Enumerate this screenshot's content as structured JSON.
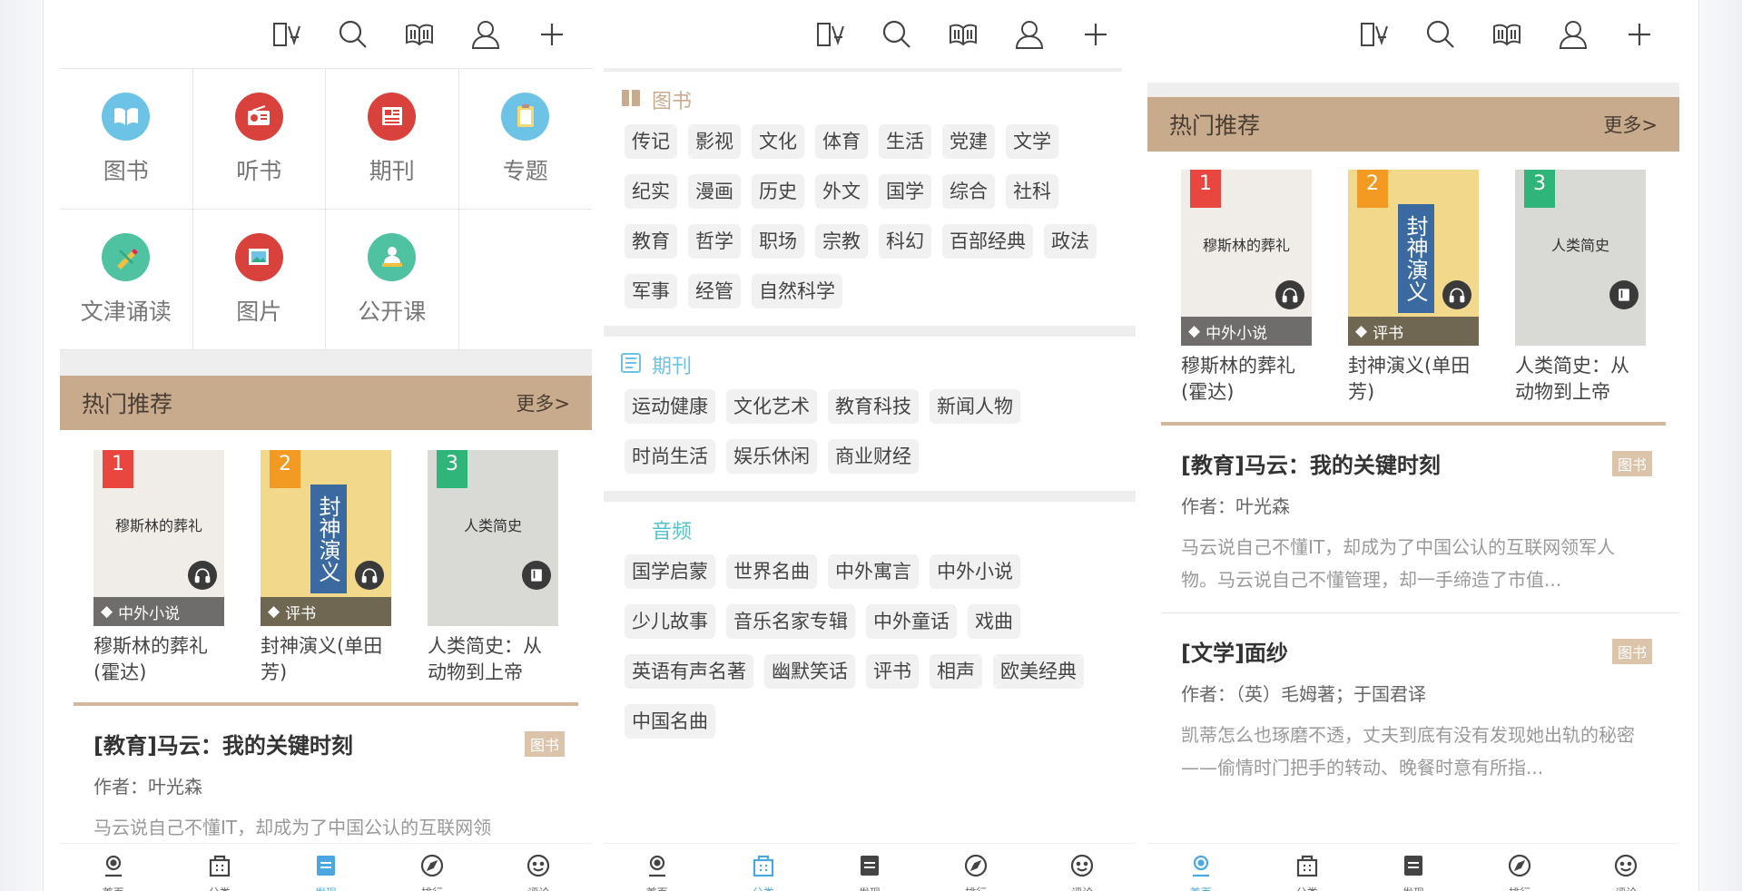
{
  "colors": {
    "accent": "#c8aa8d",
    "active_blue": "#4aa7e0",
    "tag_bg": "#f1f1f1"
  },
  "topbar_icons": [
    "font-icon",
    "search-icon",
    "book-open-icon",
    "user-icon",
    "plus-icon"
  ],
  "screen1": {
    "grid": [
      {
        "label": "图书",
        "icon": "book-icon",
        "color": "#6cc3e6"
      },
      {
        "label": "听书",
        "icon": "radio-icon",
        "color": "#d9423c"
      },
      {
        "label": "期刊",
        "icon": "newspaper-icon",
        "color": "#d9423c"
      },
      {
        "label": "专题",
        "icon": "clipboard-icon",
        "color": "#6cc3e6"
      },
      {
        "label": "文津诵读",
        "icon": "brush-icon",
        "color": "#4fc3a1"
      },
      {
        "label": "图片",
        "icon": "picture-icon",
        "color": "#d9423c"
      },
      {
        "label": "公开课",
        "icon": "teacher-icon",
        "color": "#4fc3a1"
      }
    ]
  },
  "hot": {
    "title": "热门推荐",
    "more": "更多>"
  },
  "books": [
    {
      "rank": "1",
      "rank_color": "#e8463f",
      "tag": "中外小说",
      "badge": "headphones-icon",
      "title": "穆斯林的葬礼(霍达)",
      "cover_title": "穆斯林的葬礼",
      "cover_bg": "#f0ede8"
    },
    {
      "rank": "2",
      "rank_color": "#f39a23",
      "tag": "评书",
      "badge": "headphones-icon",
      "title": "封神演义(单田芳)",
      "cover_title": "封神演义",
      "cover_bg": "#f2d88a"
    },
    {
      "rank": "3",
      "rank_color": "#2fb47a",
      "tag": "",
      "badge": "book-icon",
      "title": "人类简史：从动物到上帝",
      "cover_title": "人类简史",
      "cover_bg": "#d9d9d6"
    }
  ],
  "articles": [
    {
      "title": "[教育]马云：我的关键时刻",
      "badge": "图书",
      "author": "作者：叶光森",
      "desc": "马云说自己不懂IT，却成为了中国公认的互联网领军人物。马云说自己不懂管理，却一手缔造了市值..."
    },
    {
      "title": "[文学]面纱",
      "badge": "图书",
      "author": "作者：（英）毛姆著；于国君译",
      "desc": "凯蒂怎么也琢磨不透，丈夫到底有没有发现她出轨的秘密——偷情时门把手的转动、晚餐时意有所指..."
    }
  ],
  "screen1_partial_desc": "马云说自己不懂IT，却成为了中国公认的互联网领",
  "categories": [
    {
      "name": "图书",
      "icon": "book-closed-icon",
      "color": "#c8aa8d",
      "tags": [
        "传记",
        "影视",
        "文化",
        "体育",
        "生活",
        "党建",
        "文学",
        "纪实",
        "漫画",
        "历史",
        "外文",
        "国学",
        "综合",
        "社科",
        "教育",
        "哲学",
        "职场",
        "宗教",
        "科幻",
        "百部经典",
        "政法",
        "军事",
        "经管",
        "自然科学"
      ]
    },
    {
      "name": "期刊",
      "icon": "scroll-icon",
      "color": "#6cc3e6",
      "tags": [
        "运动健康",
        "文化艺术",
        "教育科技",
        "新闻人物",
        "时尚生活",
        "娱乐休闲",
        "商业财经"
      ]
    },
    {
      "name": "音频",
      "icon": "headphones-icon",
      "color": "#4fc3c9",
      "tags": [
        "国学启蒙",
        "世界名曲",
        "中外寓言",
        "中外小说",
        "少儿故事",
        "音乐名家专辑",
        "中外童话",
        "戏曲",
        "英语有声名著",
        "幽默笑话",
        "评书",
        "相声",
        "欧美经典",
        "中国名曲"
      ]
    }
  ],
  "nav": [
    {
      "label": "首页",
      "icon": "home-icon"
    },
    {
      "label": "分类",
      "icon": "category-icon"
    },
    {
      "label": "发现",
      "icon": "discover-icon"
    },
    {
      "label": "排行",
      "icon": "compass-icon"
    },
    {
      "label": "评论",
      "icon": "smile-icon"
    }
  ],
  "nav_active": {
    "screen1": "发现",
    "screen2": "分类",
    "screen3": "首页"
  }
}
